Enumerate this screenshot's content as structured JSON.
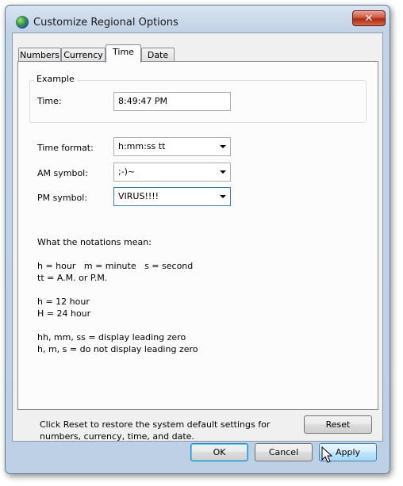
{
  "window": {
    "title": "Customize Regional Options",
    "close_glyph": "✕",
    "icon": "globe-icon"
  },
  "tabs": [
    {
      "label": "Numbers",
      "active": false
    },
    {
      "label": "Currency",
      "active": false
    },
    {
      "label": "Time",
      "active": true
    },
    {
      "label": "Date",
      "active": false
    }
  ],
  "example": {
    "group_label": "Example",
    "time_label": "Time:",
    "time_value": "8:49:47 PM"
  },
  "fields": {
    "time_format": {
      "label": "Time format:",
      "value": "h:mm:ss tt"
    },
    "am_symbol": {
      "label": "AM symbol:",
      "value": ";-)~"
    },
    "pm_symbol": {
      "label": "PM symbol:",
      "value": "VIRUS!!!!"
    }
  },
  "notations": {
    "heading": "What the notations mean:",
    "line1": "h = hour   m = minute   s = second",
    "line2": "tt = A.M. or P.M.",
    "line3": "h = 12 hour",
    "line4": "H = 24 hour",
    "line5": "hh, mm, ss = display leading zero",
    "line6": "h, m, s = do not display leading zero"
  },
  "footer": {
    "reset_text": "Click Reset to restore the system default settings for numbers, currency, time, and date.",
    "reset_button": "Reset"
  },
  "buttons": {
    "ok": "OK",
    "cancel": "Cancel",
    "apply": "Apply"
  },
  "colors": {
    "accent": "#3c7fb1",
    "close": "#c0391b",
    "frame": "#bdd0e6"
  }
}
